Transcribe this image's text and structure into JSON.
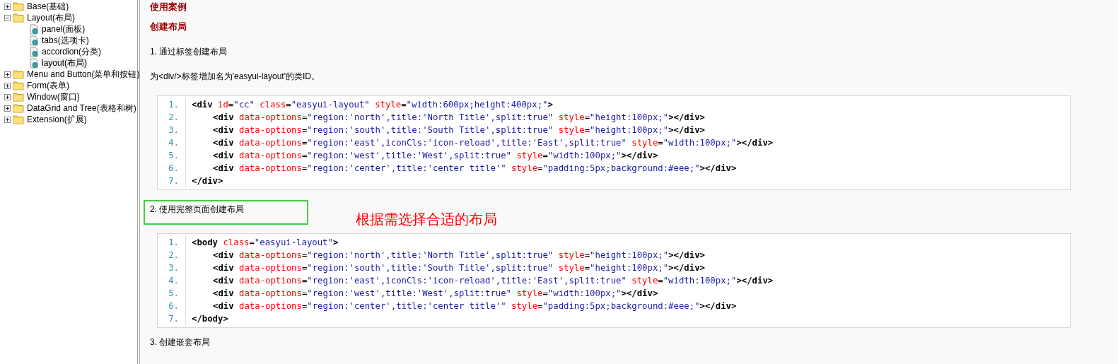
{
  "sidebar": {
    "tree": [
      {
        "label": "Base(基础)",
        "kind": "folder",
        "expanded": false,
        "selected": false
      },
      {
        "label": "Layout(布局)",
        "kind": "folder",
        "expanded": true,
        "selected": false,
        "children": [
          {
            "label": "panel(面板)",
            "kind": "page",
            "selected": false
          },
          {
            "label": "tabs(选项卡)",
            "kind": "page",
            "selected": false
          },
          {
            "label": "accordion(分类)",
            "kind": "page",
            "selected": false
          },
          {
            "label": "layout(布局)",
            "kind": "page",
            "selected": true
          }
        ]
      },
      {
        "label": "Menu and Button(菜单和按钮)",
        "kind": "folder",
        "expanded": false,
        "selected": false
      },
      {
        "label": "Form(表单)",
        "kind": "folder",
        "expanded": false,
        "selected": false
      },
      {
        "label": "Window(窗口)",
        "kind": "folder",
        "expanded": false,
        "selected": false
      },
      {
        "label": "DataGrid and Tree(表格和树)",
        "kind": "folder",
        "expanded": false,
        "selected": false
      },
      {
        "label": "Extension(扩展)",
        "kind": "folder",
        "expanded": false,
        "selected": false
      }
    ]
  },
  "content": {
    "section_title": "使用案例",
    "subtitle": "创建布局",
    "step_1": {
      "title": "1. 通过标签创建布局",
      "text": "为<div/>标签增加名为'easyui-layout'的类ID。"
    },
    "code_block_1": [
      {
        "number": "1.",
        "indent": false,
        "tokens": [
          {
            "kind": "tag",
            "text": "<div"
          },
          {
            "kind": "attr",
            "text": " id"
          },
          {
            "kind": "op",
            "text": "="
          },
          {
            "kind": "str",
            "text": "\"cc\""
          },
          {
            "kind": "attr",
            "text": " class"
          },
          {
            "kind": "op",
            "text": "="
          },
          {
            "kind": "str",
            "text": "\"easyui-layout\""
          },
          {
            "kind": "attr",
            "text": " style"
          },
          {
            "kind": "op",
            "text": "="
          },
          {
            "kind": "str",
            "text": "\"width:600px;height:400px;\""
          },
          {
            "kind": "tag",
            "text": ">"
          }
        ]
      },
      {
        "number": "2.",
        "indent": true,
        "tokens": [
          {
            "kind": "tag",
            "text": "<div"
          },
          {
            "kind": "attr",
            "text": " data-options"
          },
          {
            "kind": "op",
            "text": "="
          },
          {
            "kind": "str",
            "text": "\"region:'north',title:'North Title',split:true\""
          },
          {
            "kind": "attr",
            "text": " style"
          },
          {
            "kind": "op",
            "text": "="
          },
          {
            "kind": "str",
            "text": "\"height:100px;\""
          },
          {
            "kind": "tag",
            "text": "></div>"
          }
        ]
      },
      {
        "number": "3.",
        "indent": true,
        "tokens": [
          {
            "kind": "tag",
            "text": "<div"
          },
          {
            "kind": "attr",
            "text": " data-options"
          },
          {
            "kind": "op",
            "text": "="
          },
          {
            "kind": "str",
            "text": "\"region:'south',title:'South Title',split:true\""
          },
          {
            "kind": "attr",
            "text": " style"
          },
          {
            "kind": "op",
            "text": "="
          },
          {
            "kind": "str",
            "text": "\"height:100px;\""
          },
          {
            "kind": "tag",
            "text": "></div>"
          }
        ]
      },
      {
        "number": "4.",
        "indent": true,
        "tokens": [
          {
            "kind": "tag",
            "text": "<div"
          },
          {
            "kind": "attr",
            "text": " data-options"
          },
          {
            "kind": "op",
            "text": "="
          },
          {
            "kind": "str",
            "text": "\"region:'east',iconCls:'icon-reload',title:'East',split:true\""
          },
          {
            "kind": "attr",
            "text": " style"
          },
          {
            "kind": "op",
            "text": "="
          },
          {
            "kind": "str",
            "text": "\"width:100px;\""
          },
          {
            "kind": "tag",
            "text": "></div>"
          }
        ]
      },
      {
        "number": "5.",
        "indent": true,
        "tokens": [
          {
            "kind": "tag",
            "text": "<div"
          },
          {
            "kind": "attr",
            "text": " data-options"
          },
          {
            "kind": "op",
            "text": "="
          },
          {
            "kind": "str",
            "text": "\"region:'west',title:'West',split:true\""
          },
          {
            "kind": "attr",
            "text": " style"
          },
          {
            "kind": "op",
            "text": "="
          },
          {
            "kind": "str",
            "text": "\"width:100px;\""
          },
          {
            "kind": "tag",
            "text": "></div>"
          }
        ]
      },
      {
        "number": "6.",
        "indent": true,
        "tokens": [
          {
            "kind": "tag",
            "text": "<div"
          },
          {
            "kind": "attr",
            "text": " data-options"
          },
          {
            "kind": "op",
            "text": "="
          },
          {
            "kind": "str",
            "text": "\"region:'center',title:'center title'\""
          },
          {
            "kind": "attr",
            "text": " style"
          },
          {
            "kind": "op",
            "text": "="
          },
          {
            "kind": "str",
            "text": "\"padding:5px;background:#eee;\""
          },
          {
            "kind": "tag",
            "text": "></div>"
          }
        ]
      },
      {
        "number": "7.",
        "indent": false,
        "tokens": [
          {
            "kind": "tag",
            "text": "</div>"
          }
        ]
      }
    ],
    "step_2": {
      "title": "2. 使用完整页面创建布局",
      "annotation": "根据需选择合适的布局"
    },
    "code_block_2": [
      {
        "number": "1.",
        "indent": false,
        "tokens": [
          {
            "kind": "tag",
            "text": "<body"
          },
          {
            "kind": "attr",
            "text": " class"
          },
          {
            "kind": "op",
            "text": "="
          },
          {
            "kind": "str",
            "text": "\"easyui-layout\""
          },
          {
            "kind": "tag",
            "text": ">"
          }
        ]
      },
      {
        "number": "2.",
        "indent": true,
        "tokens": [
          {
            "kind": "tag",
            "text": "<div"
          },
          {
            "kind": "attr",
            "text": " data-options"
          },
          {
            "kind": "op",
            "text": "="
          },
          {
            "kind": "str",
            "text": "\"region:'north',title:'North Title',split:true\""
          },
          {
            "kind": "attr",
            "text": " style"
          },
          {
            "kind": "op",
            "text": "="
          },
          {
            "kind": "str",
            "text": "\"height:100px;\""
          },
          {
            "kind": "tag",
            "text": "></div>"
          }
        ]
      },
      {
        "number": "3.",
        "indent": true,
        "tokens": [
          {
            "kind": "tag",
            "text": "<div"
          },
          {
            "kind": "attr",
            "text": " data-options"
          },
          {
            "kind": "op",
            "text": "="
          },
          {
            "kind": "str",
            "text": "\"region:'south',title:'South Title',split:true\""
          },
          {
            "kind": "attr",
            "text": " style"
          },
          {
            "kind": "op",
            "text": "="
          },
          {
            "kind": "str",
            "text": "\"height:100px;\""
          },
          {
            "kind": "tag",
            "text": "></div>"
          }
        ]
      },
      {
        "number": "4.",
        "indent": true,
        "tokens": [
          {
            "kind": "tag",
            "text": "<div"
          },
          {
            "kind": "attr",
            "text": " data-options"
          },
          {
            "kind": "op",
            "text": "="
          },
          {
            "kind": "str",
            "text": "\"region:'east',iconCls:'icon-reload',title:'East',split:true\""
          },
          {
            "kind": "attr",
            "text": " style"
          },
          {
            "kind": "op",
            "text": "="
          },
          {
            "kind": "str",
            "text": "\"width:100px;\""
          },
          {
            "kind": "tag",
            "text": "></div>"
          }
        ]
      },
      {
        "number": "5.",
        "indent": true,
        "tokens": [
          {
            "kind": "tag",
            "text": "<div"
          },
          {
            "kind": "attr",
            "text": " data-options"
          },
          {
            "kind": "op",
            "text": "="
          },
          {
            "kind": "str",
            "text": "\"region:'west',title:'West',split:true\""
          },
          {
            "kind": "attr",
            "text": " style"
          },
          {
            "kind": "op",
            "text": "="
          },
          {
            "kind": "str",
            "text": "\"width:100px;\""
          },
          {
            "kind": "tag",
            "text": "></div>"
          }
        ]
      },
      {
        "number": "6.",
        "indent": true,
        "tokens": [
          {
            "kind": "tag",
            "text": "<div"
          },
          {
            "kind": "attr",
            "text": " data-options"
          },
          {
            "kind": "op",
            "text": "="
          },
          {
            "kind": "str",
            "text": "\"region:'center',title:'center title'\""
          },
          {
            "kind": "attr",
            "text": " style"
          },
          {
            "kind": "op",
            "text": "="
          },
          {
            "kind": "str",
            "text": "\"padding:5px;background:#eee;\""
          },
          {
            "kind": "tag",
            "text": "></div>"
          }
        ]
      },
      {
        "number": "7.",
        "indent": false,
        "tokens": [
          {
            "kind": "tag",
            "text": "</body>"
          }
        ]
      }
    ],
    "step_3": {
      "title": "3. 创建嵌套布局"
    }
  }
}
